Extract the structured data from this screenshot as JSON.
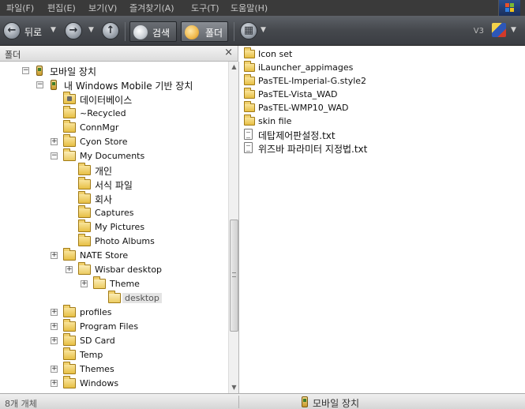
{
  "menubar": {
    "items": [
      "파일(F)",
      "편집(E)",
      "보기(V)",
      "즐겨찾기(A)",
      "도구(T)",
      "도움말(H)"
    ]
  },
  "toolbar": {
    "back_label": "뒤로",
    "search_label": "검색",
    "folders_label": "폴더",
    "version_label": "V3"
  },
  "folder_pane": {
    "title": "폴더",
    "close_glyph": "×"
  },
  "tree": {
    "root_label": "모바일 장치",
    "device_label": "내 Windows Mobile 기반 장치",
    "items": [
      {
        "label": "데이터베이스"
      },
      {
        "label": "~Recycled"
      },
      {
        "label": "ConnMgr"
      },
      {
        "label": "Cyon Store"
      },
      {
        "label": "My Documents"
      },
      {
        "label": "개인"
      },
      {
        "label": "서식 파일"
      },
      {
        "label": "회사"
      },
      {
        "label": "Captures"
      },
      {
        "label": "My Pictures"
      },
      {
        "label": "Photo Albums"
      },
      {
        "label": "NATE Store"
      },
      {
        "label": "Wisbar desktop"
      },
      {
        "label": "Theme"
      },
      {
        "label": "desktop"
      },
      {
        "label": "profiles"
      },
      {
        "label": "Program Files"
      },
      {
        "label": "SD Card"
      },
      {
        "label": "Temp"
      },
      {
        "label": "Themes"
      },
      {
        "label": "Windows"
      }
    ]
  },
  "files": {
    "items": [
      {
        "label": "Icon set",
        "icon": "folder-icon"
      },
      {
        "label": "iLauncher_appimages",
        "icon": "folder-icon"
      },
      {
        "label": "PasTEL-Imperial-G.style2",
        "icon": "folder-icon"
      },
      {
        "label": "PasTEL-Vista_WAD",
        "icon": "folder-icon"
      },
      {
        "label": "PasTEL-WMP10_WAD",
        "icon": "folder-icon"
      },
      {
        "label": "skin file",
        "icon": "folder-icon"
      },
      {
        "label": "데탑제어판설정.txt",
        "icon": "text-file-icon"
      },
      {
        "label": "위즈바 파라미터 지정법.txt",
        "icon": "text-file-icon"
      }
    ]
  },
  "statusbar": {
    "count": "8개 개체",
    "location": "모바일 장치"
  }
}
